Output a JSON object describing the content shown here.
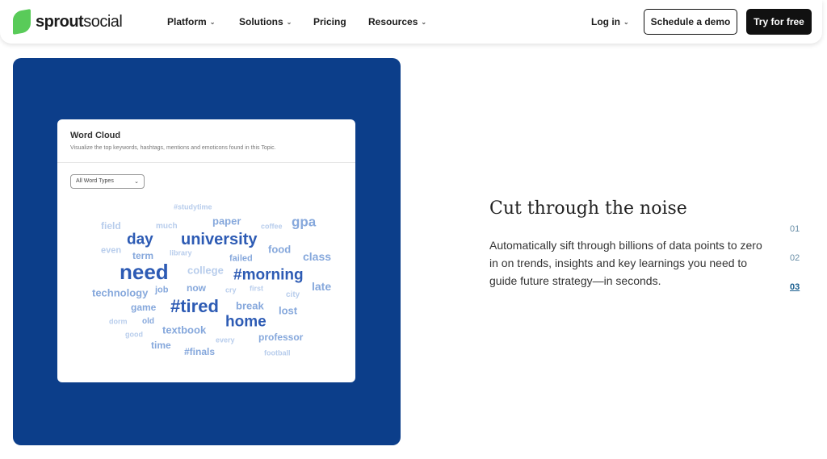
{
  "nav": {
    "logo_bold": "sprout",
    "logo_light": "social",
    "items": [
      {
        "label": "Platform",
        "dropdown": true
      },
      {
        "label": "Solutions",
        "dropdown": true
      },
      {
        "label": "Pricing",
        "dropdown": false
      },
      {
        "label": "Resources",
        "dropdown": true
      }
    ],
    "login": "Log in",
    "demo": "Schedule a demo",
    "try": "Try for free"
  },
  "card": {
    "title": "Word Cloud",
    "subtitle": "Visualize the top keywords, hashtags, mentions and emoticons found in this Topic.",
    "filter": "All Word Types"
  },
  "colors": {
    "panel": "#0c3e8a",
    "word_strong": "#2d5bb4",
    "word_medium": "#86a8dc",
    "word_light": "#b8cdec"
  },
  "words": [
    "#studytime",
    "field",
    "much",
    "paper",
    "coffee",
    "gpa",
    "day",
    "university",
    "even",
    "term",
    "library",
    "food",
    "failed",
    "class",
    "need",
    "college",
    "#morning",
    "technology",
    "job",
    "now",
    "cry",
    "first",
    "city",
    "late",
    "game",
    "#tired",
    "break",
    "lost",
    "dorm",
    "old",
    "home",
    "textbook",
    "good",
    "every",
    "professor",
    "time",
    "#finals",
    "football"
  ],
  "feature": {
    "heading": "Cut through the noise",
    "body": "Automatically sift through billions of data points to zero in on trends, insights and key learnings you need to guide future strategy—in seconds.",
    "steps": [
      "01",
      "02",
      "03"
    ],
    "active_step": "03"
  }
}
